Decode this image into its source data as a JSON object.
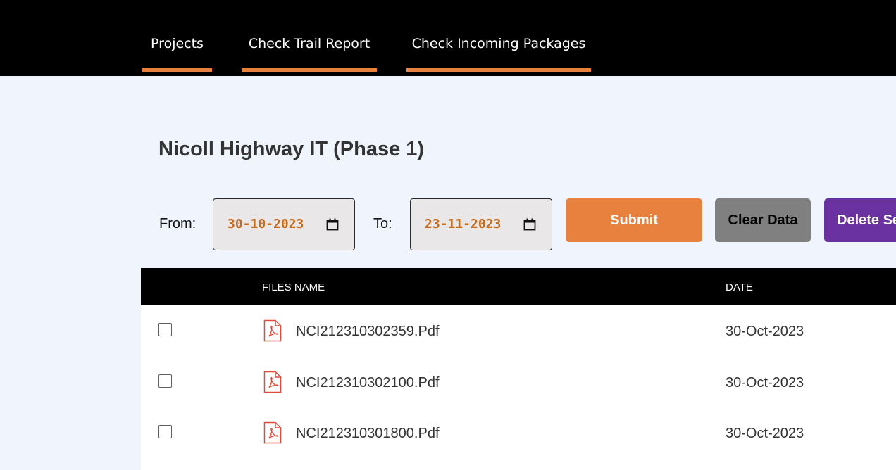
{
  "nav": {
    "tabs": [
      {
        "label": "Projects"
      },
      {
        "label": "Check Trail Report"
      },
      {
        "label": "Check Incoming Packages"
      }
    ],
    "accent": "#e8803e"
  },
  "page": {
    "title": "Nicoll Highway IT (Phase 1)"
  },
  "filters": {
    "from_label": "From:",
    "from_value": "30-10-2023",
    "to_label": "To:",
    "to_value": "23-11-2023"
  },
  "actions": {
    "submit_label": "Submit",
    "clear_label": "Clear Data",
    "delete_label": "Delete Se"
  },
  "table": {
    "headers": {
      "files_name": "FILES NAME",
      "date": "DATE"
    },
    "rows": [
      {
        "file": "NCI212310302359.Pdf",
        "date": "30-Oct-2023",
        "icon": "pdf-icon",
        "checked": false
      },
      {
        "file": "NCI212310302100.Pdf",
        "date": "30-Oct-2023",
        "icon": "pdf-icon",
        "checked": false
      },
      {
        "file": "NCI212310301800.Pdf",
        "date": "30-Oct-2023",
        "icon": "pdf-icon",
        "checked": false
      }
    ]
  },
  "colors": {
    "submit": "#e8803e",
    "clear": "#808080",
    "delete": "#6a32a0",
    "date_text": "#c86a1a"
  }
}
